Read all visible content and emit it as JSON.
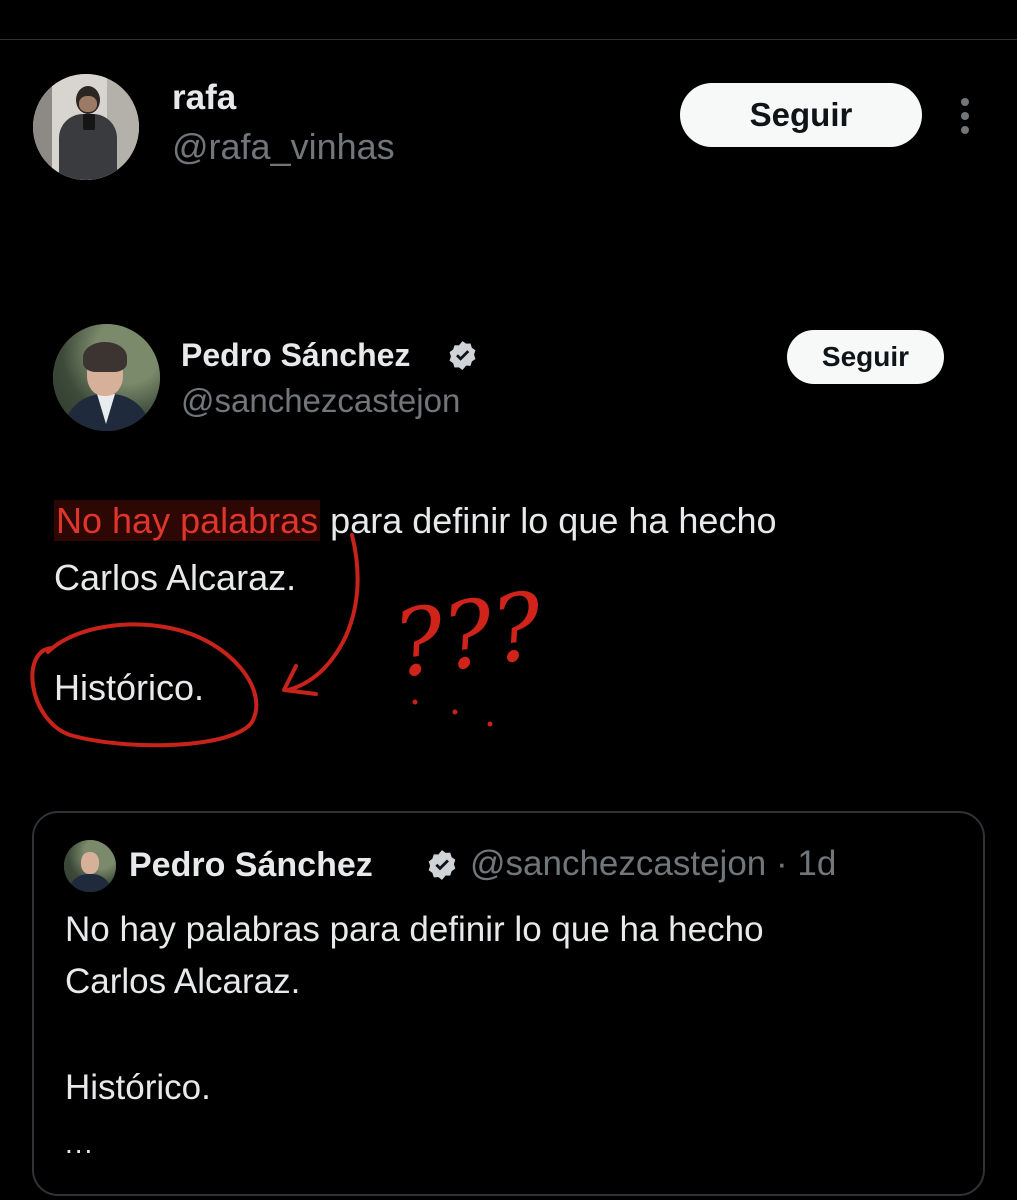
{
  "post": {
    "author_name": "rafa",
    "author_handle": "@rafa_vinhas",
    "follow_label": "Seguir"
  },
  "screenshot": {
    "author_name": "Pedro Sánchez",
    "author_handle": "@sanchezcastejon",
    "follow_label": "Seguir",
    "line1_highlight": "No hay palabras",
    "line1_rest": " para definir lo que ha hecho",
    "line2": "Carlos Alcaraz.",
    "line3": "Histórico.",
    "annotation": "???"
  },
  "quote": {
    "author_name": "Pedro Sánchez",
    "meta": "@sanchezcastejon · 1d",
    "line1": "No hay palabras para definir lo que ha hecho",
    "line2": "Carlos Alcaraz.",
    "line3": "Histórico.",
    "ellipsis": "..."
  },
  "icons": {
    "verified": "verified-badge-icon",
    "more": "more-options-icon"
  },
  "colors": {
    "background": "#000000",
    "text": "#e7e9ea",
    "muted": "#71767b",
    "annotation_red": "#d0241b",
    "button_bg": "#f7f9f9"
  }
}
